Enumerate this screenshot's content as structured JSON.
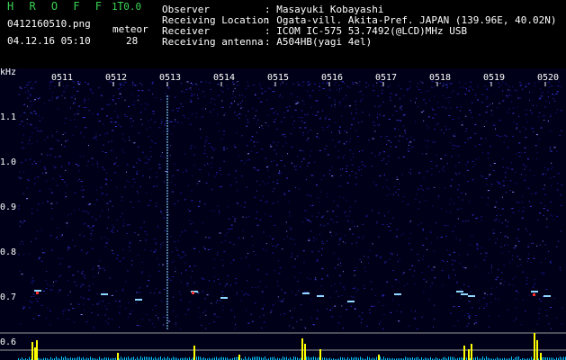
{
  "app": {
    "brand": "H R O F F T",
    "version": "1.0.0",
    "filename": "0412160510.png",
    "datetime": "04.12.16 05:10",
    "meteor_label": "meteor",
    "meteor_count": "28"
  },
  "info": {
    "rows": [
      {
        "label": "Observer",
        "value": ": Masayuki Kobayashi"
      },
      {
        "label": "Receiving Location",
        "value": ": Ogata-vill. Akita-Pref. JAPAN (139.96E, 40.02N)"
      },
      {
        "label": "Receiver",
        "value": ": ICOM IC-575 53.7492(@LCD)MHz USB"
      },
      {
        "label": "Receiving antenna",
        "value": ": A504HB(yagi 4el)"
      }
    ]
  },
  "spectrogram": {
    "yunit": "kHz",
    "time_ticks": [
      "0511",
      "0512",
      "0513",
      "0514",
      "0515",
      "0516",
      "0517",
      "0518",
      "0519",
      "0520"
    ],
    "freq_ticks": [
      "1.1",
      "1.0",
      "0.9",
      "0.8",
      "0.7",
      "0.6"
    ],
    "colors": {
      "background": "#000018",
      "noise": "#1a1aa0",
      "signal": "#8fd8ff",
      "hit": "#ff3030",
      "meter": "#ffff00",
      "meter_base": "#00c8ff"
    }
  }
}
